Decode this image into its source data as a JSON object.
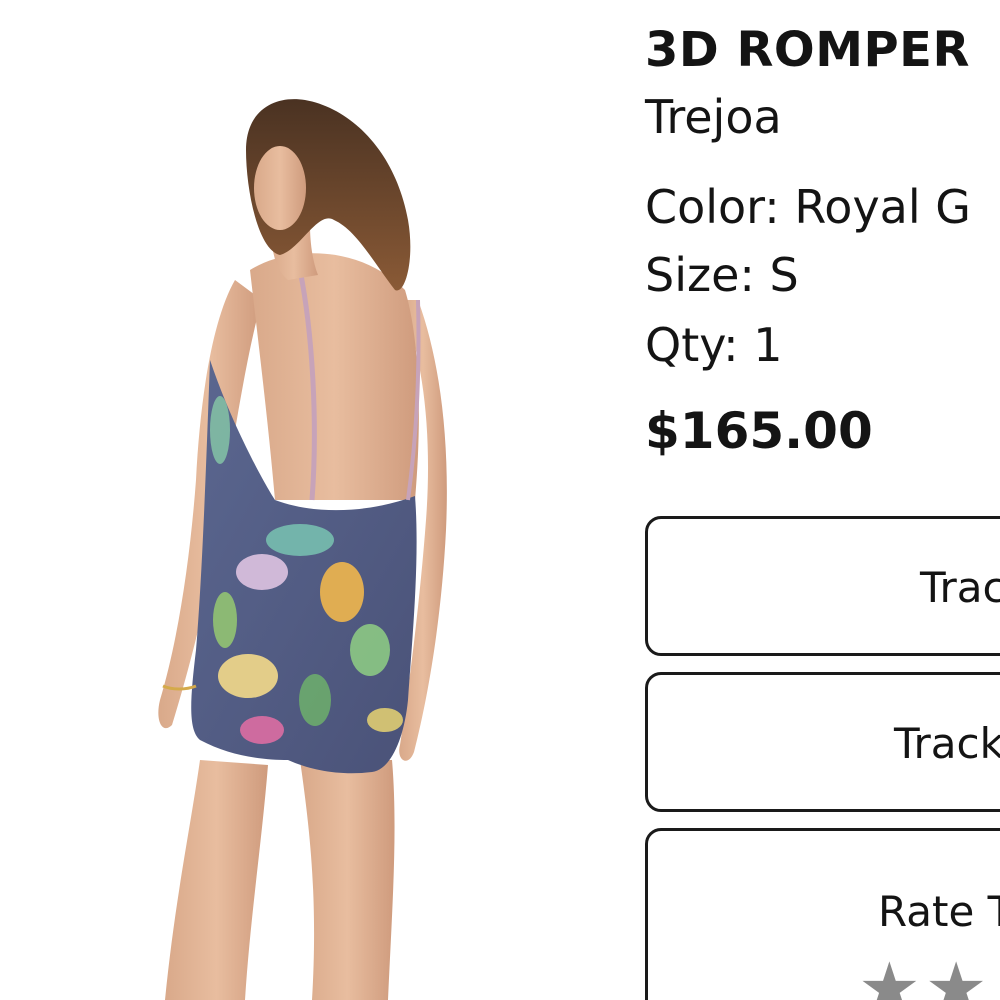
{
  "product": {
    "title": "3D ROMPER",
    "brand": "Trejoa",
    "color_label": "Color: Royal G",
    "size_label": "Size: S",
    "qty_label": "Qty: 1",
    "price": "$165.00",
    "image_alt": "Model wearing floral backless romper"
  },
  "buttons": {
    "track_1": "Trac",
    "track_2": "Track",
    "rate": "Rate T"
  },
  "rating": {
    "stars": [
      "★",
      "★"
    ],
    "star_color": "#8a8a8a"
  },
  "colors": {
    "text": "#141414",
    "button_border": "#1a1a1a",
    "background": "#ffffff"
  }
}
